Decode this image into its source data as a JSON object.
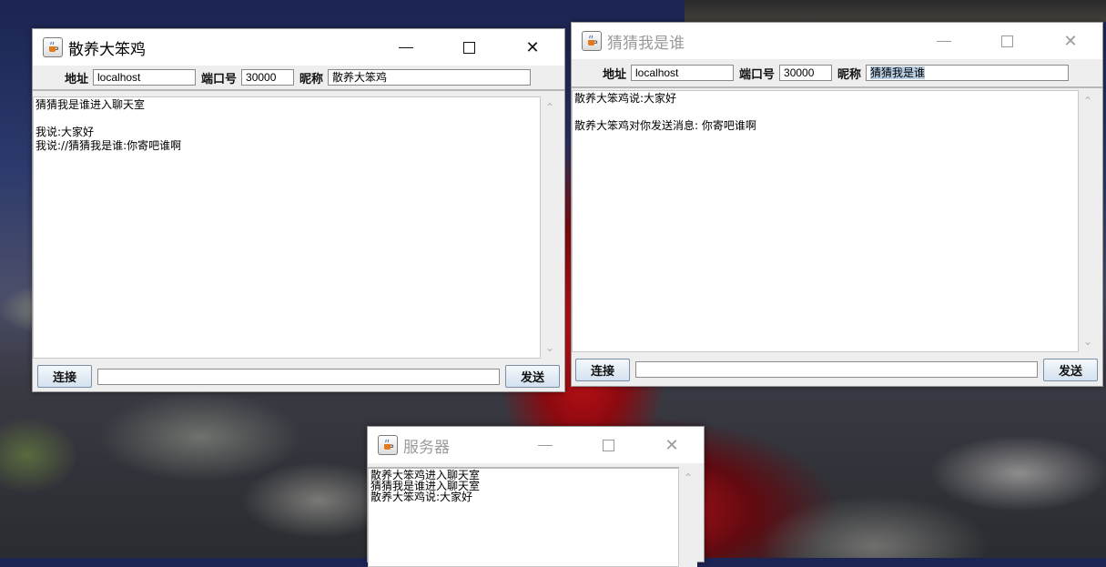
{
  "colors": {
    "selection": "#b8cfe5",
    "button_border": "#7a8ea8",
    "window_bg": "#eeeeee"
  },
  "icons": {
    "app": "java-coffee-cup-icon",
    "minimize": "minimize-icon",
    "maximize": "maximize-icon",
    "close": "close-icon",
    "scroll_up": "chevron-up-icon",
    "scroll_down": "chevron-down-icon"
  },
  "windows": [
    {
      "title": "散养大笨鸡",
      "active": true,
      "address_label": "地址",
      "address_value": "localhost",
      "port_label": "端口号",
      "port_value": "30000",
      "nick_label": "昵称",
      "nick_value": "散养大笨鸡",
      "chat_text": "猜猜我是谁进入聊天室\n\n我说:大家好\n我说://猜猜我是谁:你寄吧谁啊",
      "connect_label": "连接",
      "send_label": "发送",
      "message_value": ""
    },
    {
      "title": "猜猜我是谁",
      "active": false,
      "address_label": "地址",
      "address_value": "localhost",
      "port_label": "端口号",
      "port_value": "30000",
      "nick_label": "昵称",
      "nick_value": "猜猜我是谁",
      "chat_text": "散养大笨鸡说:大家好\n\n散养大笨鸡对你发送消息: 你寄吧谁啊",
      "connect_label": "连接",
      "send_label": "发送",
      "message_value": ""
    }
  ],
  "server": {
    "title": "服务器",
    "log_text": "散养大笨鸡进入聊天室\n猜猜我是谁进入聊天室\n散养大笨鸡说:大家好"
  }
}
